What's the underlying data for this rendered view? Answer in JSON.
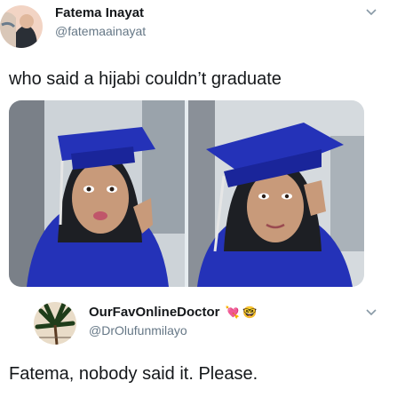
{
  "tweet": {
    "author_name": "Fatema Inayat",
    "author_handle": "@fatemaainayat",
    "text": "who said a hijabi couldn’t graduate",
    "more_icon": "chevron-down-icon",
    "media_count": 2
  },
  "reply": {
    "author_name": "OurFavOnlineDoctor",
    "author_emoji": "💘 🤓",
    "author_handle": "@DrOlufunmilayo",
    "text": "Fatema, nobody said it. Please.",
    "more_icon": "chevron-down-icon"
  },
  "colors": {
    "text": "#14171a",
    "secondary_text": "#657786",
    "gown_blue": "#2432b8",
    "background": "#ffffff"
  }
}
